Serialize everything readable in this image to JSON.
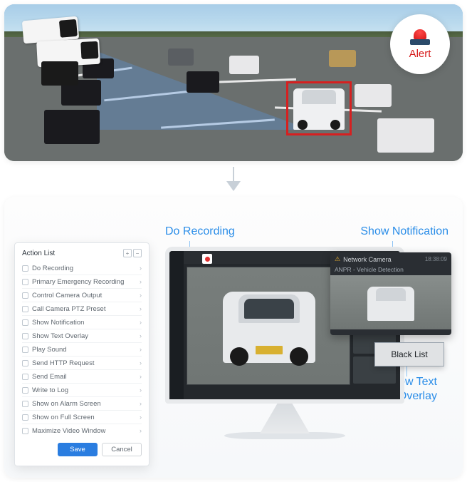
{
  "alert": {
    "label": "Alert"
  },
  "callouts": {
    "do_recording": "Do Recording",
    "show_notification": "Show Notification",
    "show_text_overlay_l1": "Show Text",
    "show_text_overlay_l2": "Overlay"
  },
  "action_list": {
    "title": "Action List",
    "items": [
      "Do Recording",
      "Primary Emergency Recording",
      "Control Camera Output",
      "Call Camera PTZ Preset",
      "Show Notification",
      "Show Text Overlay",
      "Play Sound",
      "Send HTTP Request",
      "Send Email",
      "Write to Log",
      "Show on Alarm Screen",
      "Show on Full Screen",
      "Maximize Video Window"
    ],
    "save": "Save",
    "cancel": "Cancel",
    "plus": "+",
    "minus": "−"
  },
  "notification": {
    "title": "Network Camera",
    "time": "18:38:09",
    "subtitle": "ANPR - Vehicle Detection"
  },
  "black_list": {
    "label": "Black List"
  }
}
